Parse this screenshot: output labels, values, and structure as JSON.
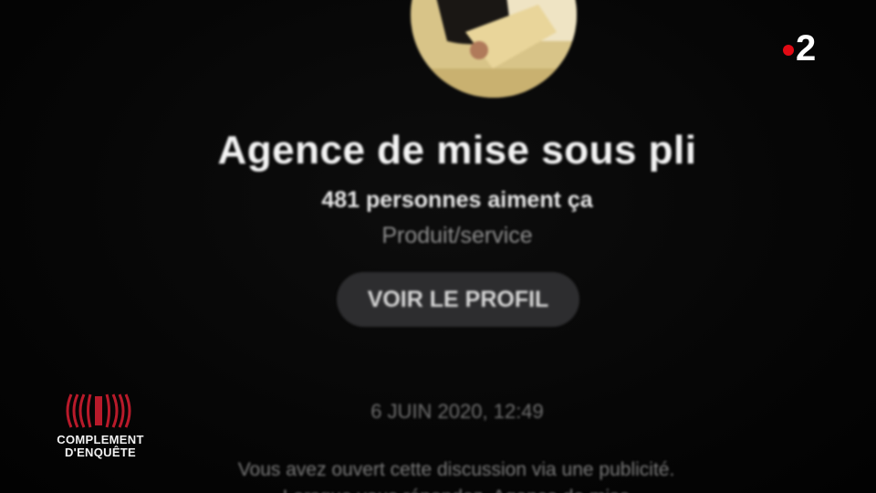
{
  "page": {
    "name": "Agence de mise sous pli",
    "likes": "481 personnes aiment ça",
    "category": "Produit/service",
    "profile_button": "VOIR LE PROFIL"
  },
  "conversation": {
    "date": "6 JUIN 2020, 12:49",
    "intro": "Vous avez ouvert cette discussion via une publicité. Lorsque vous répondez, Agence de mise"
  },
  "overlay": {
    "channel_number": "2",
    "show_line1": "COMPLEMENT",
    "show_line2": "D'ENQUÊTE"
  },
  "colors": {
    "channel_dot": "#e10a14",
    "show_mark": "#b81a2a",
    "button_bg": "#2d2d2f"
  },
  "icons": {
    "avatar": "profile-photo",
    "channel": "france2-logo",
    "show": "complement-denquete-logo"
  }
}
